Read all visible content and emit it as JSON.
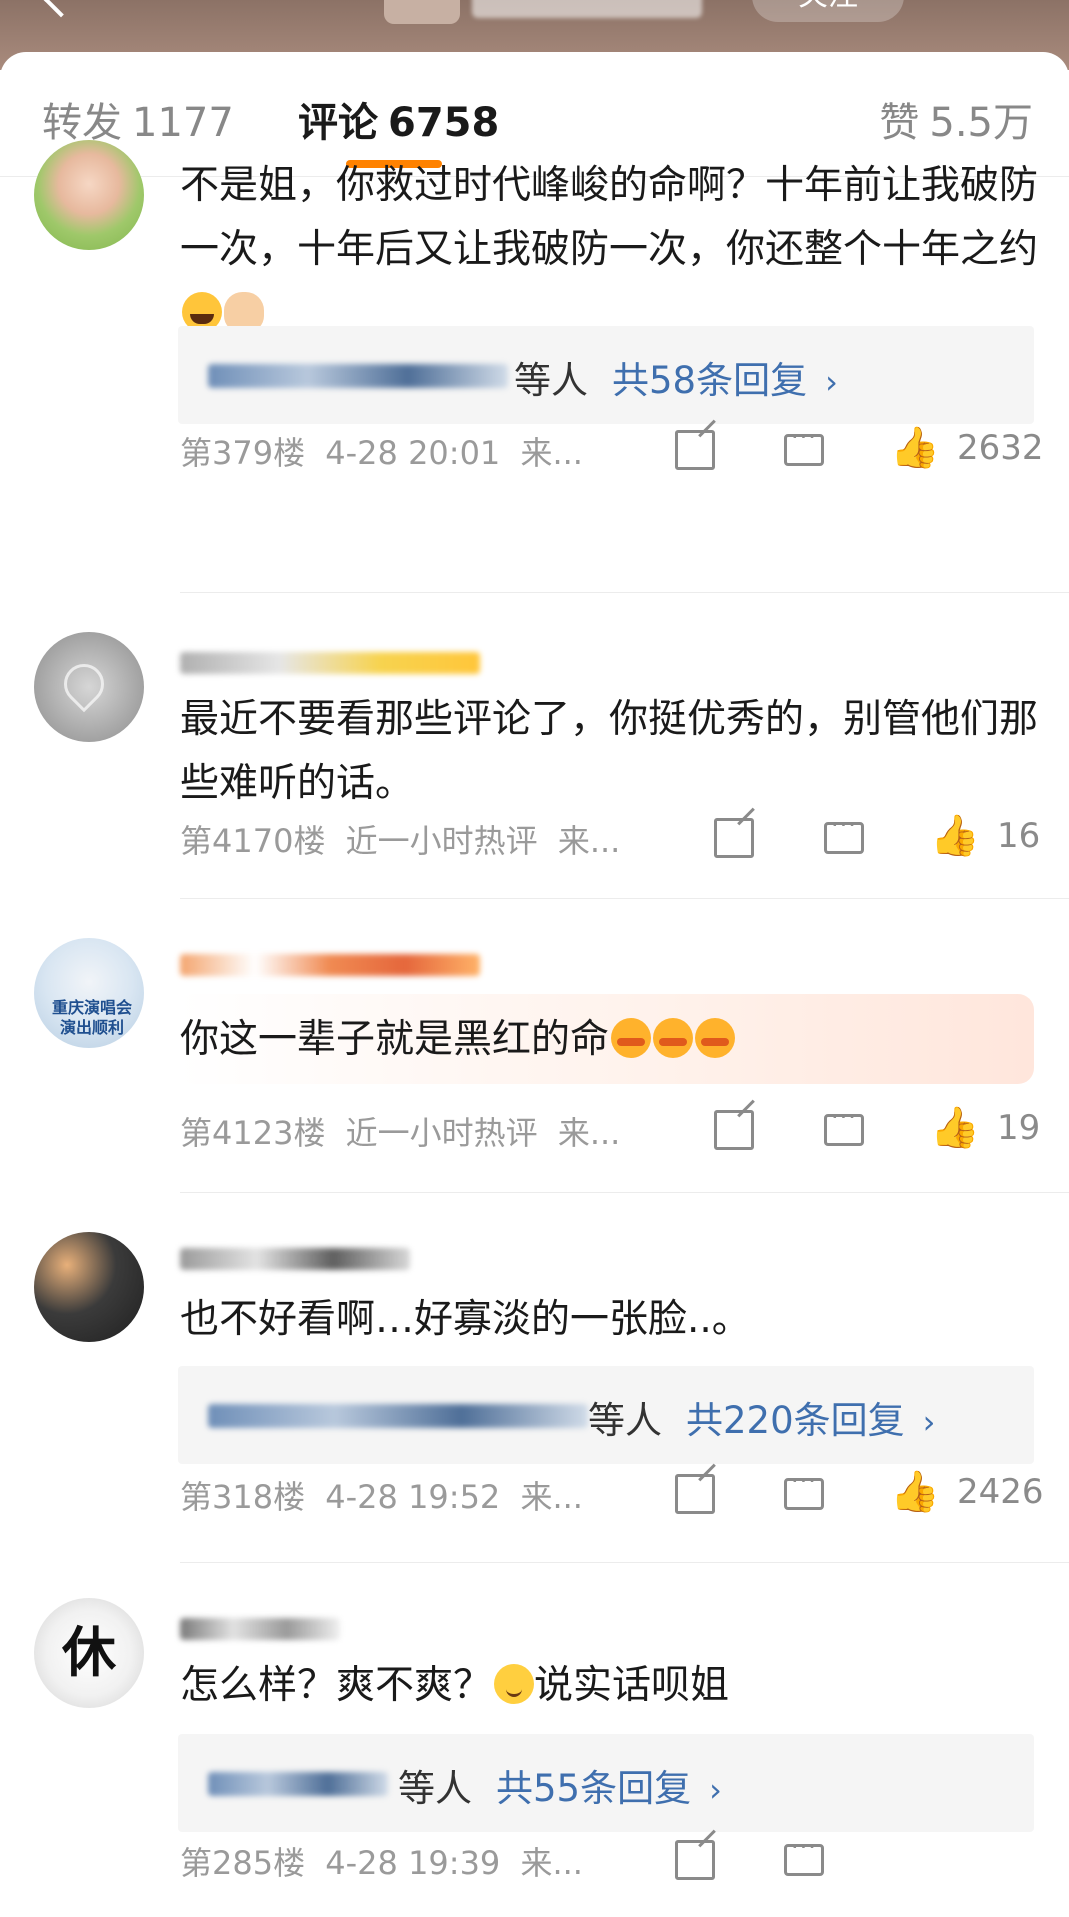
{
  "header": {
    "follow_label": "关注"
  },
  "tabs": {
    "repost": {
      "label": "转发",
      "count": "1177"
    },
    "comments": {
      "label": "评论",
      "count": "6758"
    },
    "likes": {
      "label": "赞",
      "count": "5.5万"
    }
  },
  "comments": [
    {
      "text": "不是姐，你救过时代峰峻的命啊？十年前让我破防一次，十年后又让我破防一次，你还整个十年之约",
      "emojis": [
        "laugh-cry-icon",
        "ok-hand-icon"
      ],
      "reply": {
        "suffix": "等人",
        "link": "共58条回复"
      },
      "floor": "第379楼",
      "time": "4-28 20:01",
      "source": "来...",
      "likes": "2632"
    },
    {
      "text": "最近不要看那些评论了，你挺优秀的，别管他们那些难听的话。",
      "floor": "第4170楼",
      "time": "近一小时热评",
      "source": "来...",
      "likes": "16"
    },
    {
      "text": "你这一辈子就是黑红的命",
      "emojis": [
        "angry-icon",
        "angry-icon",
        "angry-icon"
      ],
      "avatar_text": "重庆演唱会演出顺利",
      "floor": "第4123楼",
      "time": "近一小时热评",
      "source": "来...",
      "likes": "19"
    },
    {
      "text": "也不好看啊…好寡淡的一张脸..。",
      "reply": {
        "suffix": "等人",
        "link": "共220条回复"
      },
      "floor": "第318楼",
      "time": "4-28 19:52",
      "source": "来...",
      "likes": "2426"
    },
    {
      "text_before": "怎么样？爽不爽？",
      "emoji": "smile-icon",
      "text_after": "说实话呗姐",
      "avatar_text": "休",
      "reply": {
        "suffix": "等人",
        "link": "共55条回复"
      },
      "floor": "第285楼",
      "time": "4-28 19:39",
      "source": "来..."
    }
  ],
  "colors": {
    "accent": "#ff8200",
    "link": "#3f6fae",
    "meta": "#9a9a9a"
  }
}
